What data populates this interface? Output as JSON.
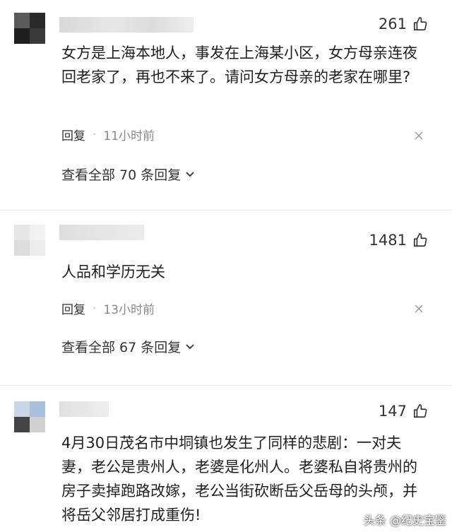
{
  "comments": [
    {
      "likes": "261",
      "text": "女方是上海本地人，事发在上海某小区，女方母亲连夜回老家了，再也不来了。请问女方母亲的老家在哪里?",
      "reply_label": "回复",
      "time": "11小时前",
      "view_replies": "查看全部 70 条回复"
    },
    {
      "likes": "1481",
      "text": "人品和学历无关",
      "reply_label": "回复",
      "time": "13小时前",
      "view_replies": "查看全部 67 条回复"
    },
    {
      "likes": "147",
      "text": "4月30日茂名市中垌镇也发生了同样的悲剧：一对夫妻，老公是贵州人，老婆是化州人。老婆私自将贵州的房子卖掉跑路改嫁，老公当街砍断岳父岳母的头颅，并将岳父邻居打成重伤!"
    }
  ],
  "watermark": "头条 @纪史宝鉴",
  "icons": {
    "like": "thumbs-up-icon",
    "close": "close-icon",
    "chevron": "chevron-down-icon"
  }
}
